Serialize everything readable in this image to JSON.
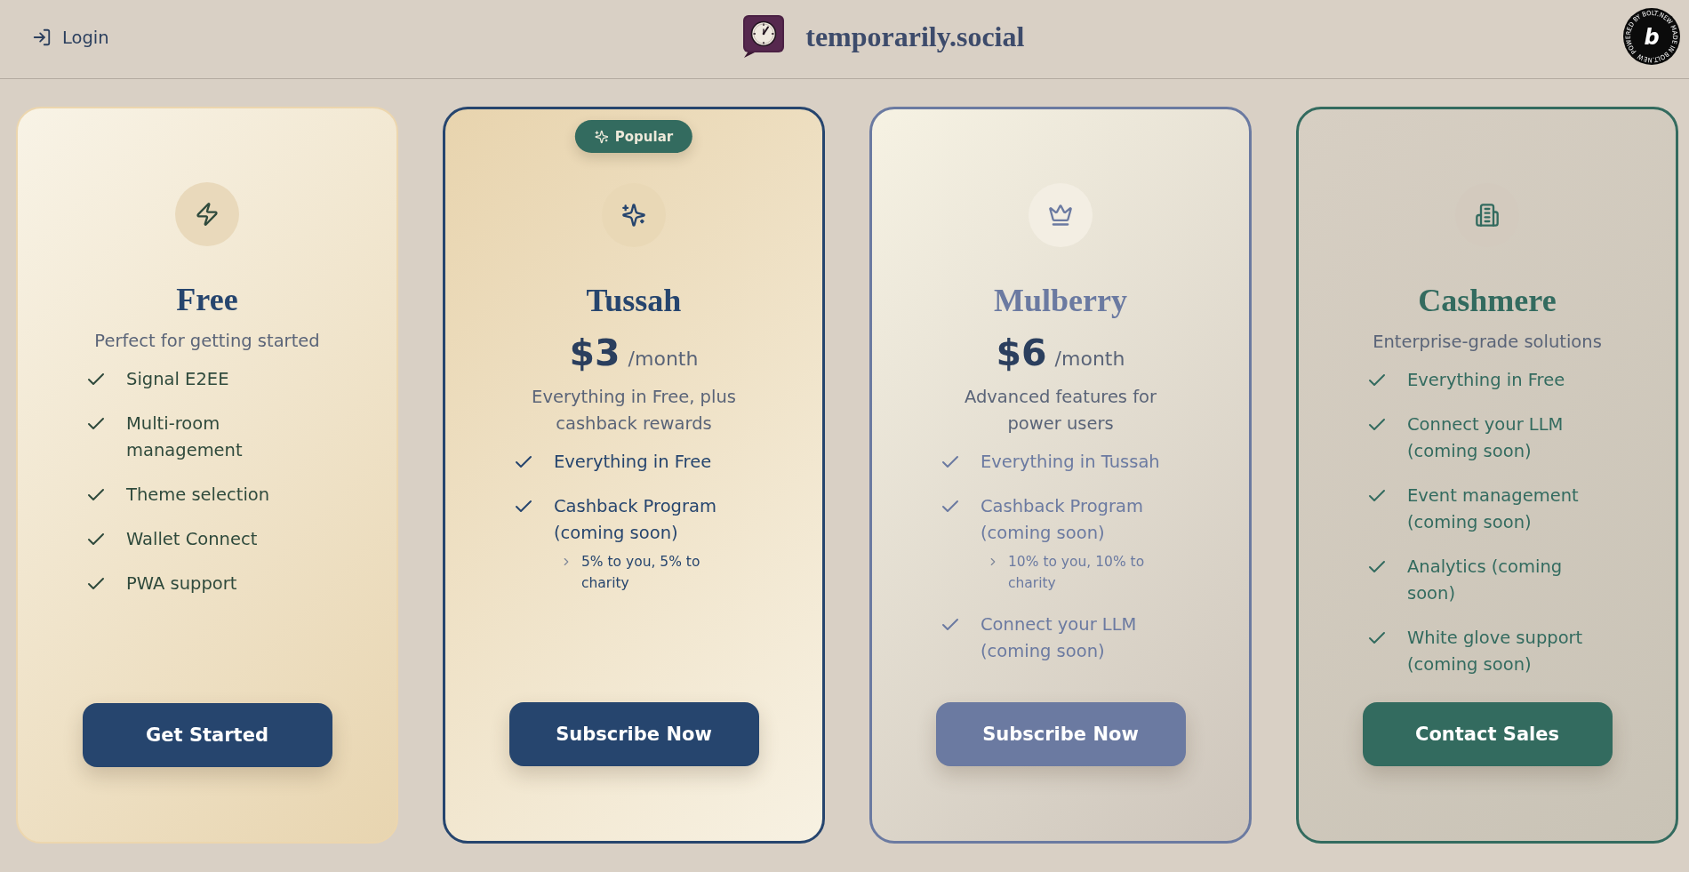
{
  "header": {
    "login": "Login",
    "brand": "temporarily.social",
    "badge": {
      "letter": "b",
      "ring_text": "POWERED BY BOLT.NEW MADE IN BOLT.NEW"
    }
  },
  "plans": [
    {
      "kind": "free",
      "name": "Free",
      "color": "#26456e",
      "tagline": "Perfect for getting started",
      "features": [
        {
          "text": "Signal E2EE"
        },
        {
          "text": "Multi-room management"
        },
        {
          "text": "Theme selection"
        },
        {
          "text": "Wallet Connect"
        },
        {
          "text": "PWA support"
        }
      ],
      "cta": "Get Started"
    },
    {
      "kind": "basic",
      "name": "Tussah",
      "color": "#26456e",
      "badge": "Popular",
      "price": "$3",
      "period": "/month",
      "tagline": "Everything in Free, plus cashback rewards",
      "features": [
        {
          "text": "Everything in Free"
        },
        {
          "text": "Cashback Program (coming soon)",
          "children": [
            {
              "text": "5% to you, 5% to charity"
            }
          ]
        }
      ],
      "cta": "Subscribe Now"
    },
    {
      "kind": "premium",
      "name": "Mulberry",
      "color": "#6b7aa1",
      "price": "$6",
      "period": "/month",
      "tagline": "Advanced features for power users",
      "features": [
        {
          "text": "Everything in Tussah"
        },
        {
          "text": "Cashback Program (coming soon)",
          "children": [
            {
              "text": "10% to you, 10% to charity"
            }
          ]
        },
        {
          "text": "Connect your LLM (coming soon)"
        }
      ],
      "cta": "Subscribe Now"
    },
    {
      "kind": "enterprise",
      "name": "Cashmere",
      "color": "#336b5f",
      "tagline": "Enterprise-grade solutions",
      "features": [
        {
          "text": "Everything in Free"
        },
        {
          "text": "Connect your LLM (coming soon)"
        },
        {
          "text": "Event management (coming soon)"
        },
        {
          "text": "Analytics (coming soon)"
        },
        {
          "text": "White glove support (coming soon)"
        }
      ],
      "cta": "Contact Sales"
    }
  ]
}
